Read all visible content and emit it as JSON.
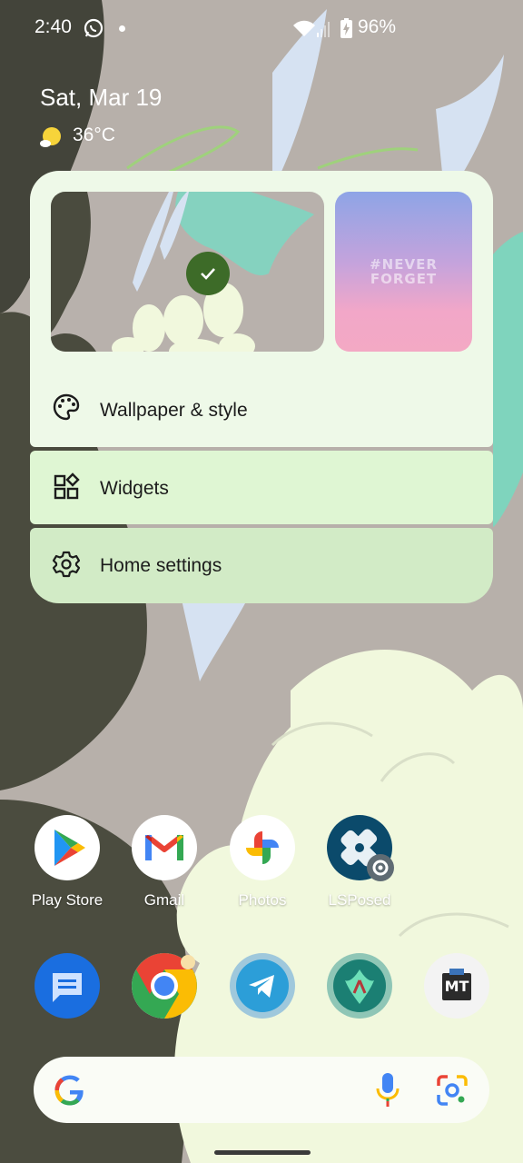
{
  "status_bar": {
    "time": "2:40",
    "battery": "96%",
    "icons": [
      "whatsapp-icon",
      "notification-dot",
      "wifi-icon",
      "signal-icon",
      "battery-charging-icon"
    ]
  },
  "at_a_glance": {
    "date": "Sat, Mar 19",
    "temperature": "36°C",
    "weather_icon": "sunny-icon"
  },
  "popup_menu": {
    "wallpaper_previews": [
      {
        "name": "current-wallpaper",
        "selected": true
      },
      {
        "name": "alternate-wallpaper",
        "text": "#NEVER FORGET"
      }
    ],
    "items": [
      {
        "label": "Wallpaper & style",
        "icon": "palette-icon"
      },
      {
        "label": "Widgets",
        "icon": "widgets-icon"
      },
      {
        "label": "Home settings",
        "icon": "gear-icon"
      }
    ]
  },
  "apps_row": [
    {
      "label": "Play Store",
      "icon": "play-store-icon"
    },
    {
      "label": "Gmail",
      "icon": "gmail-icon"
    },
    {
      "label": "Photos",
      "icon": "photos-icon"
    },
    {
      "label": "LSPosed",
      "icon": "lsposed-icon"
    }
  ],
  "dock": [
    {
      "icon": "messages-icon"
    },
    {
      "icon": "chrome-icon"
    },
    {
      "icon": "telegram-icon"
    },
    {
      "icon": "magisk-icon"
    },
    {
      "icon": "mt-manager-icon",
      "text": "MT"
    }
  ],
  "search_bar": {
    "icons": [
      "google-logo-icon",
      "microphone-icon",
      "lens-icon"
    ]
  },
  "colors": {
    "popup_bg": "#eef9e8",
    "widgets_row": "#dff6d3",
    "home_settings_row": "#d2ebc6",
    "check_green": "#3d6b28"
  }
}
